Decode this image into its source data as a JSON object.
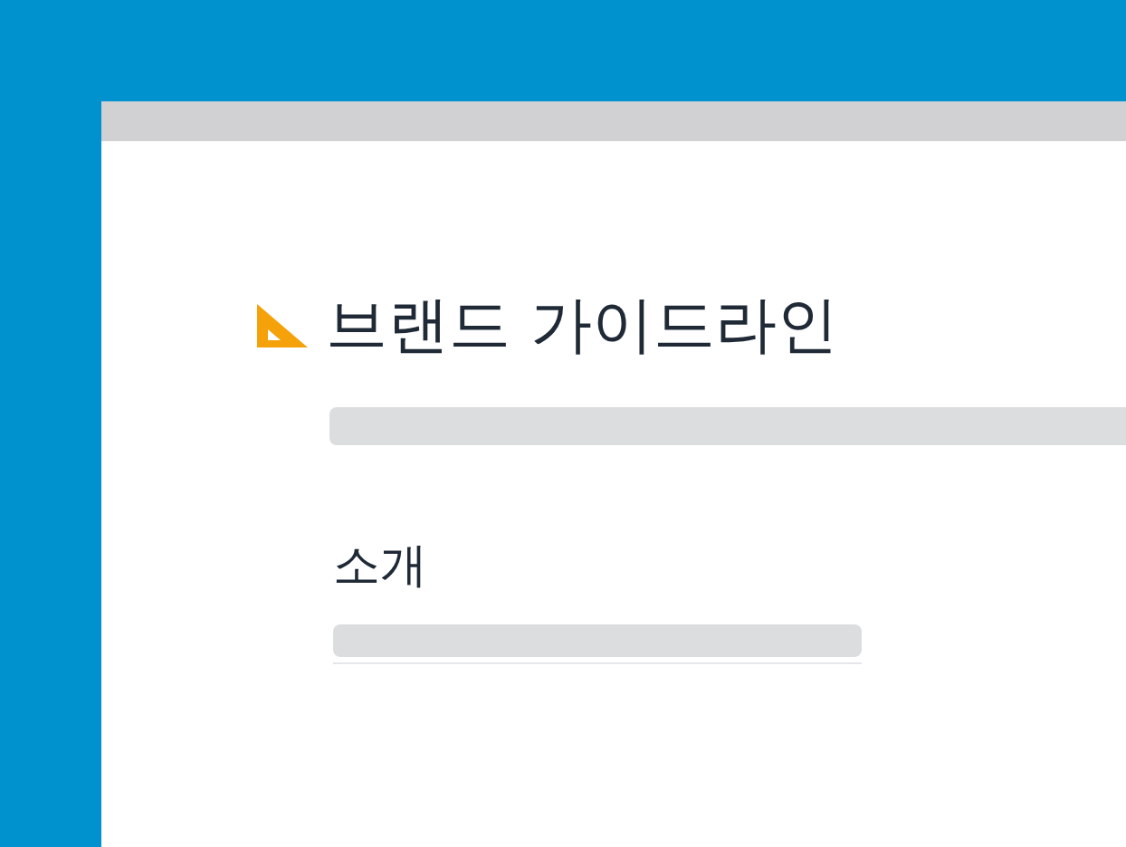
{
  "page": {
    "title": "브랜드 가이드라인",
    "sections": [
      {
        "heading": "소개"
      }
    ]
  }
}
